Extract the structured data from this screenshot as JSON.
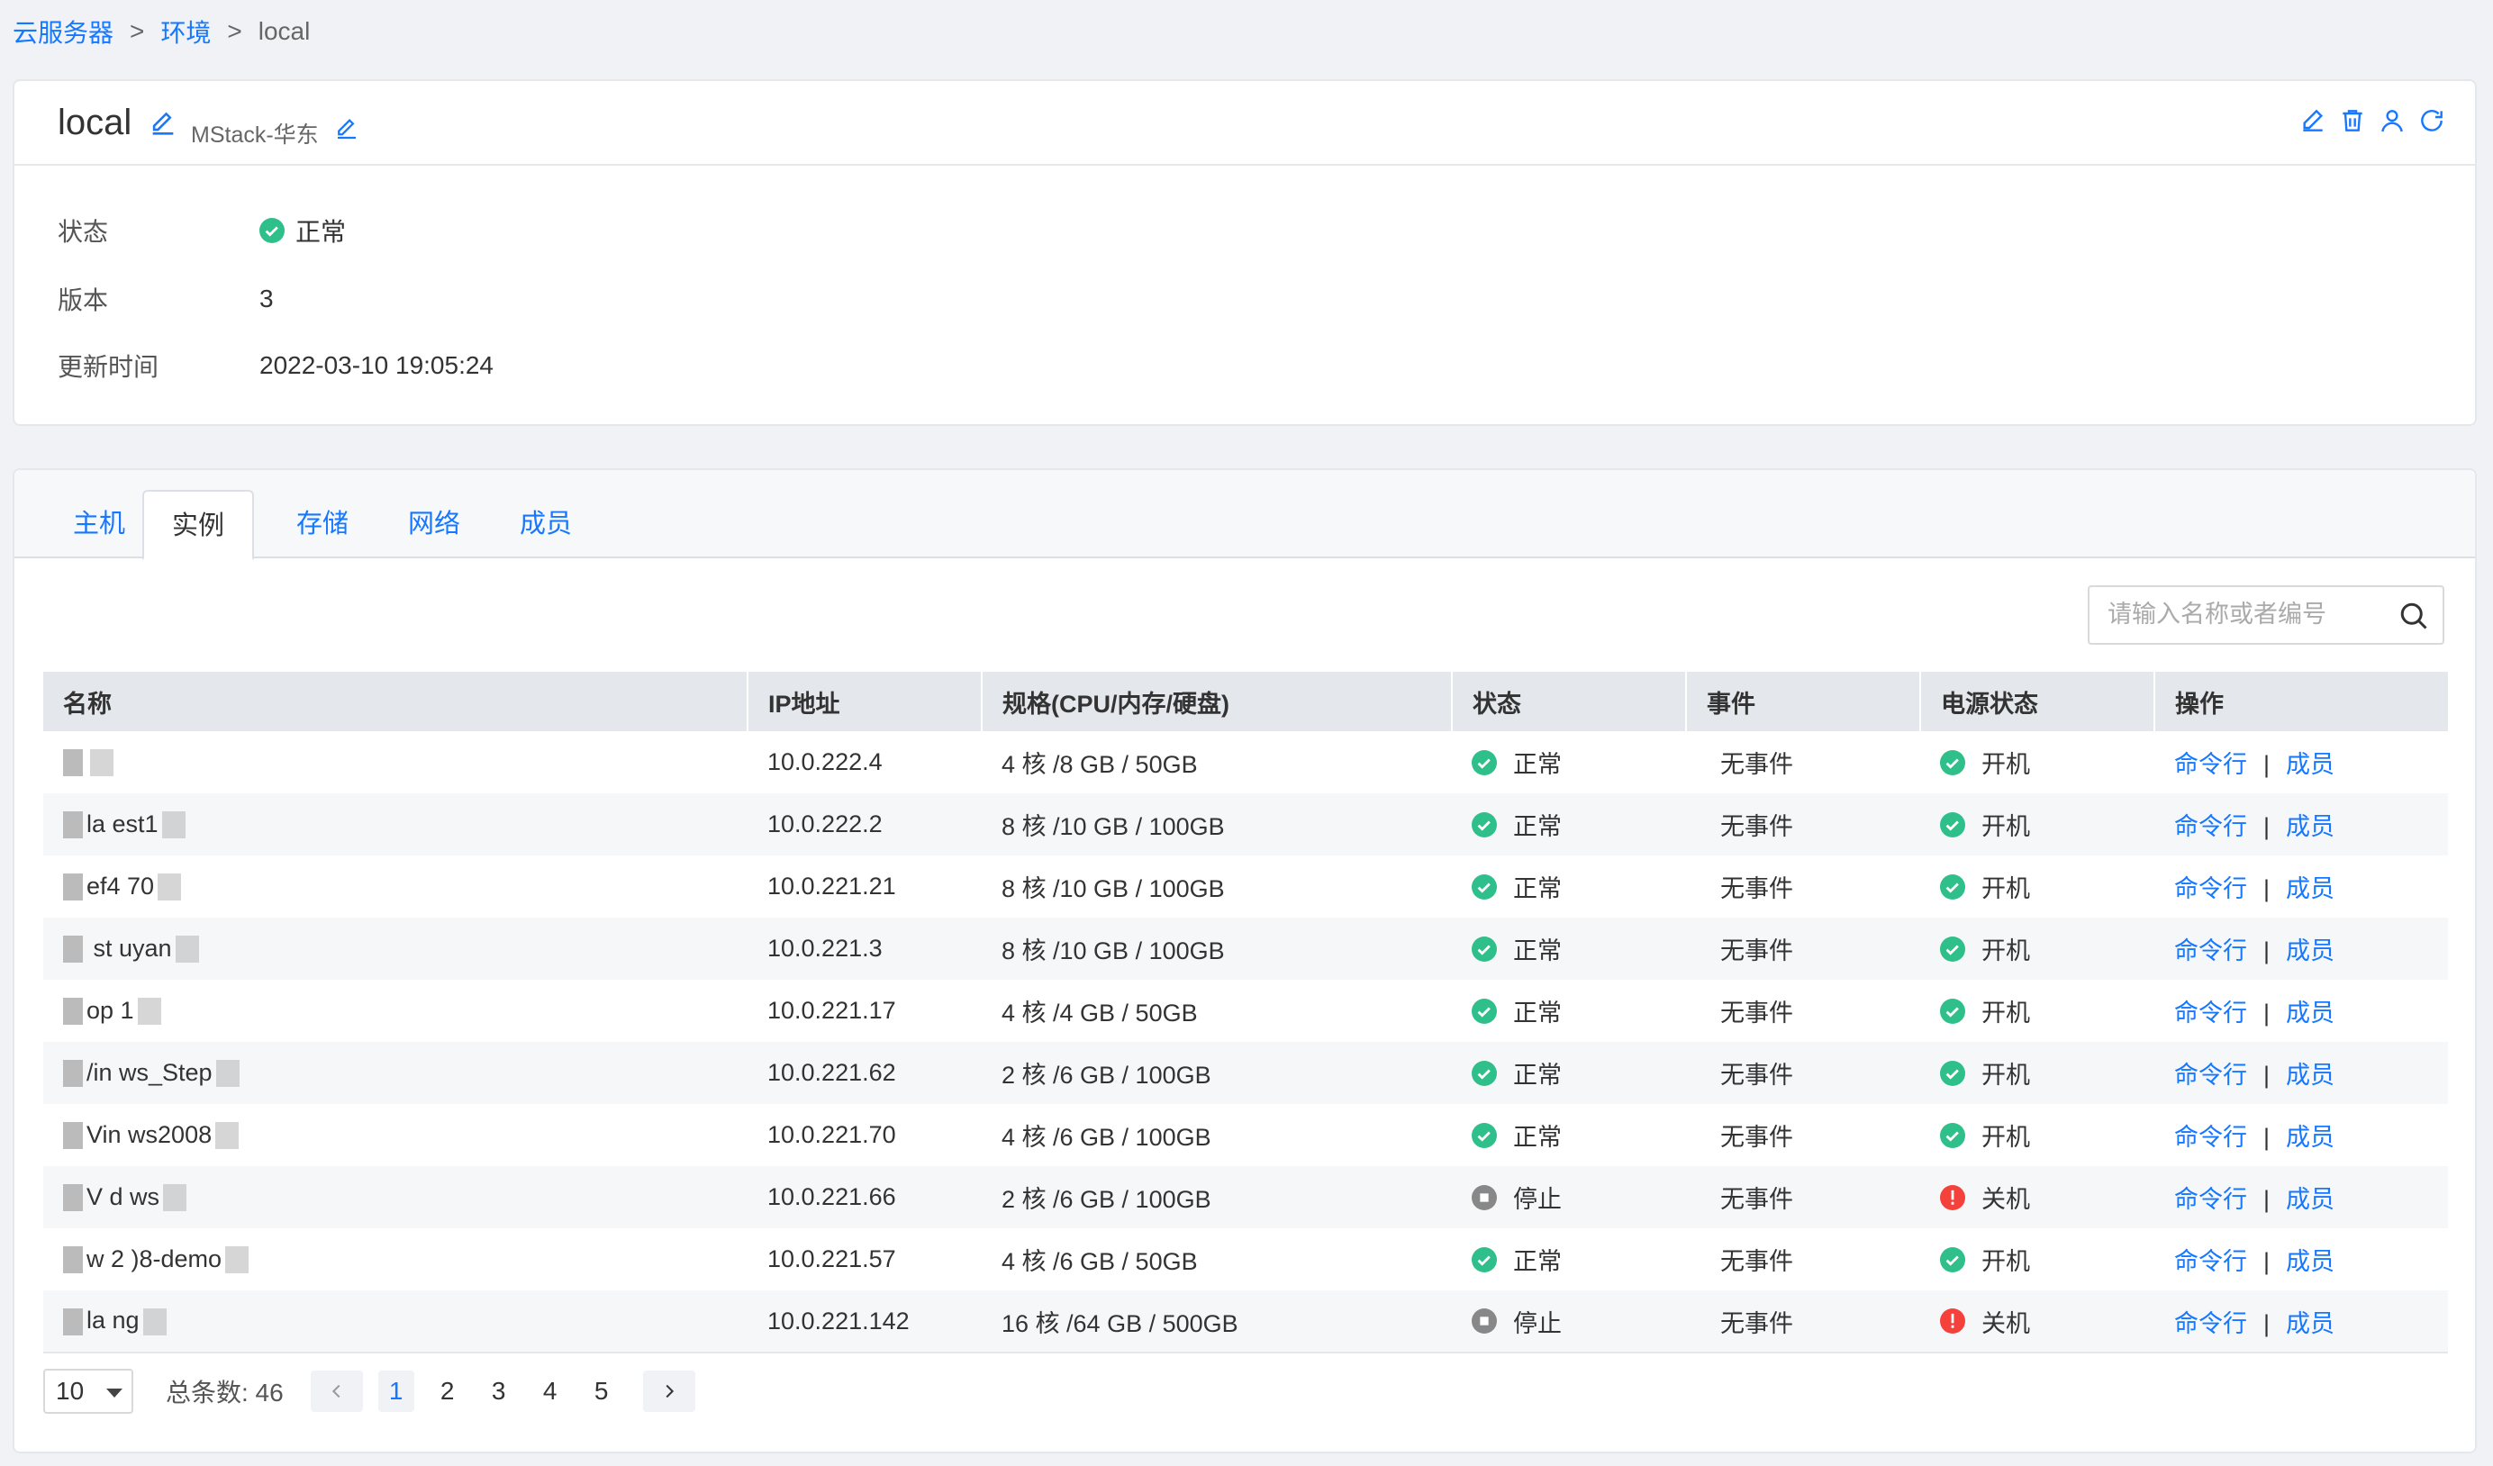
{
  "breadcrumb": {
    "item1": "云服务器",
    "sep1": ">",
    "item2": "环境",
    "sep2": ">",
    "current": "local"
  },
  "env": {
    "name": "local",
    "region": "MStack-华东",
    "status_label": "状态",
    "status_value": "正常",
    "version_label": "版本",
    "version_value": "3",
    "updated_label": "更新时间",
    "updated_value": "2022-03-10 19:05:24"
  },
  "tabs": [
    "主机",
    "实例",
    "存储",
    "网络",
    "成员"
  ],
  "search": {
    "placeholder": "请输入名称或者编号"
  },
  "table": {
    "headers": [
      "名称",
      "IP地址",
      "规格(CPU/内存/硬盘)",
      "状态",
      "事件",
      "电源状态",
      "操作"
    ],
    "rows": [
      {
        "name": "",
        "ip": "10.0.222.4",
        "spec": "4 核 /8 GB / 50GB",
        "status": "正常",
        "event": "无事件",
        "power": "开机",
        "op1": "命令行",
        "op2": "成员"
      },
      {
        "name": "la  est1",
        "ip": "10.0.222.2",
        "spec": "8 核 /10 GB / 100GB",
        "status": "正常",
        "event": "无事件",
        "power": "开机",
        "op1": "命令行",
        "op2": "成员"
      },
      {
        "name": "ef4  70",
        "ip": "10.0.221.21",
        "spec": "8 核 /10 GB / 100GB",
        "status": "正常",
        "event": "无事件",
        "power": "开机",
        "op1": "命令行",
        "op2": "成员"
      },
      {
        "name": "  st  uyan",
        "ip": "10.0.221.3",
        "spec": "8 核 /10 GB / 100GB",
        "status": "正常",
        "event": "无事件",
        "power": "开机",
        "op1": "命令行",
        "op2": "成员"
      },
      {
        "name": "op  1",
        "ip": "10.0.221.17",
        "spec": "4 核 /4 GB / 50GB",
        "status": "正常",
        "event": "无事件",
        "power": "开机",
        "op1": "命令行",
        "op2": "成员"
      },
      {
        "name": "/in  ws_Step",
        "ip": "10.0.221.62",
        "spec": "2 核 /6 GB / 100GB",
        "status": "正常",
        "event": "无事件",
        "power": "开机",
        "op1": "命令行",
        "op2": "成员"
      },
      {
        "name": "Vin  ws2008",
        "ip": "10.0.221.70",
        "spec": "4 核 /6 GB / 100GB",
        "status": "正常",
        "event": "无事件",
        "power": "开机",
        "op1": "命令行",
        "op2": "成员"
      },
      {
        "name": "V  d  ws",
        "ip": "10.0.221.66",
        "spec": "2 核 /6 GB / 100GB",
        "status": "停止",
        "event": "无事件",
        "power": "关机",
        "op1": "命令行",
        "op2": "成员"
      },
      {
        "name": "w  2  )8-demo",
        "ip": "10.0.221.57",
        "spec": "4 核 /6 GB / 50GB",
        "status": "正常",
        "event": "无事件",
        "power": "开机",
        "op1": "命令行",
        "op2": "成员"
      },
      {
        "name": "la  ng",
        "ip": "10.0.221.142",
        "spec": "16 核 /64 GB / 500GB",
        "status": "停止",
        "event": "无事件",
        "power": "关机",
        "op1": "命令行",
        "op2": "成员"
      }
    ]
  },
  "pager": {
    "size": "10",
    "total": "总条数: 46",
    "pages": [
      "1",
      "2",
      "3",
      "4",
      "5"
    ],
    "current": "1"
  },
  "colors": {
    "accent": "#1677ff",
    "ok": "#2fbf8a",
    "stop": "#888888",
    "off": "#f5413b"
  },
  "icons": {
    "edit": "edit-icon",
    "delete": "trash-icon",
    "member": "user-icon",
    "refresh": "refresh-icon",
    "search": "search-icon"
  }
}
